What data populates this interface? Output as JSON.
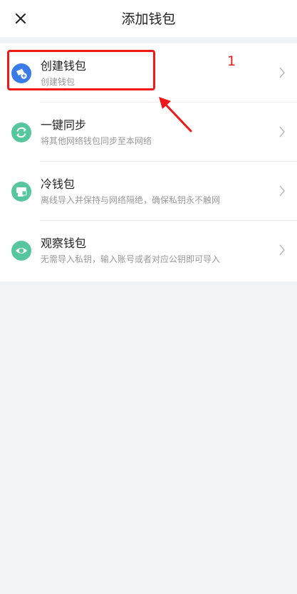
{
  "header": {
    "title": "添加钱包",
    "close_icon": "close-icon"
  },
  "items": [
    {
      "title": "创建钱包",
      "subtitle": "创建钱包",
      "icon": "wallet-add-icon",
      "icon_color": "#3b7be8"
    },
    {
      "title": "一键同步",
      "subtitle": "将其他网络钱包同步至本网络",
      "icon": "sync-icon",
      "icon_color": "#55c69d"
    },
    {
      "title": "冷钱包",
      "subtitle": "离线导入并保持与网络隔绝，确保私钥永不触网",
      "icon": "cold-wallet-icon",
      "icon_color": "#55c69d"
    },
    {
      "title": "观察钱包",
      "subtitle": "无需导入私钥，输入账号或者对应公钥即可导入",
      "icon": "eye-icon",
      "icon_color": "#55c69d"
    }
  ],
  "annotation": {
    "number": "1",
    "color": "#f01818"
  },
  "colors": {
    "background": "#f2f3f5",
    "surface": "#ffffff",
    "chevron": "#bbbbbb"
  }
}
